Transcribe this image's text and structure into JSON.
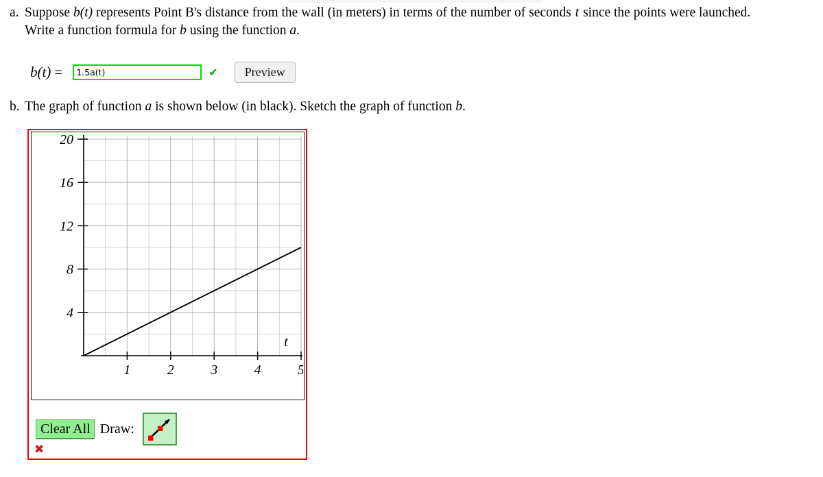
{
  "top_strip": {
    "present": true,
    "color": "#f4f4f4"
  },
  "part_a": {
    "marker": "a.",
    "line1_pre": "Suppose ",
    "var_b_of_t": "b(t)",
    "line1_mid": " represents Point B's distance from the wall (in meters) in terms of the number of seconds ",
    "var_t": "t",
    "line1_post": " since the points were launched.",
    "line2_pre": "Write a function formula for ",
    "var_b": "b",
    "line2_mid": " using the function ",
    "var_a": "a",
    "line2_post": "."
  },
  "formula": {
    "lhs_b": "b",
    "lhs_paren_open": "(",
    "lhs_t": "t",
    "lhs_paren_close": ")",
    "equals": "=",
    "input_value": "1.5a(t)",
    "input_placeholder": "",
    "check_icon": "check-mark-icon",
    "check_glyph": "✔",
    "check_color": "#00a600",
    "input_border_color": "#00e000",
    "preview_label": "Preview"
  },
  "part_b": {
    "marker": "b.",
    "text_pre": "The graph of function ",
    "var_a": "a",
    "text_mid": " is shown below (in black). Sketch the graph of function ",
    "var_b": "b",
    "text_post": "."
  },
  "graph": {
    "border_color": "#ff0000",
    "canvas_border_color": "#1a1a1a",
    "controls": {
      "clear_all_label": "Clear All",
      "clear_all_bg": "#90ee90",
      "draw_label": "Draw:",
      "draw_tool_icon": "line-segment-draw-icon",
      "draw_tool_bg": "#c5f0c5"
    },
    "status": {
      "icon": "incorrect-x-icon",
      "glyph": "✖",
      "color": "#e11010"
    }
  },
  "chart_data": {
    "type": "line",
    "title": "",
    "xlabel": "t",
    "ylabel": "",
    "xlim": [
      0,
      5
    ],
    "ylim": [
      0,
      20
    ],
    "xticks": [
      1,
      2,
      3,
      4,
      5
    ],
    "xtick_labels": [
      "1",
      "2",
      "3",
      "4",
      "5"
    ],
    "yticks": [
      4,
      8,
      12,
      16,
      20
    ],
    "ytick_labels": [
      "4",
      "8",
      "12",
      "16",
      "20"
    ],
    "grid": true,
    "grid_x_minor_step": 0.5,
    "grid_y_minor_step": 2,
    "legend": "none",
    "series": [
      {
        "name": "a",
        "color": "#000000",
        "points": [
          [
            0,
            0
          ],
          [
            5,
            10
          ]
        ],
        "slope": 2,
        "intercept": 0
      }
    ]
  }
}
